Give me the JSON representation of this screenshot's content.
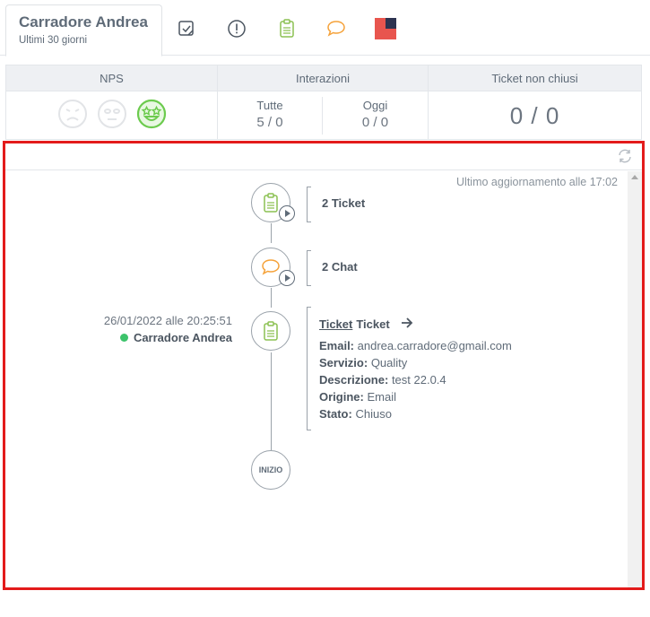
{
  "header": {
    "name": "Carradore Andrea",
    "period": "Ultimi 30 giorni",
    "tabs": [
      {
        "icon": "note-check-icon"
      },
      {
        "icon": "alert-circle-icon"
      },
      {
        "icon": "clipboard-icon",
        "color": "#8cc152"
      },
      {
        "icon": "chat-bubble-icon",
        "color": "#f5a23a"
      },
      {
        "icon": "flag-icon",
        "color": "#e8554e"
      }
    ]
  },
  "stats": {
    "nps": {
      "label": "NPS",
      "faces": [
        "sad-face-icon",
        "neutral-face-icon",
        "star-eyes-face-icon"
      ],
      "active_color": "#6ccb4e"
    },
    "interazioni": {
      "label": "Interazioni",
      "tutte_label": "Tutte",
      "tutte_value": "5 / 0",
      "oggi_label": "Oggi",
      "oggi_value": "0 / 0"
    },
    "ticket": {
      "label": "Ticket non chiusi",
      "value": "0 / 0"
    }
  },
  "timeline": {
    "updated": "Ultimo aggiornamento alle 17:02",
    "events": [
      {
        "title": "2 Ticket",
        "icon": "clipboard-icon"
      },
      {
        "title": "2 Chat",
        "icon": "chat-bubble-icon"
      }
    ],
    "entry": {
      "date": "26/01/2022 alle 20:25:51",
      "agent": "Carradore Andrea",
      "link": "Ticket",
      "type": "Ticket",
      "fields": [
        {
          "key": "Email:",
          "value": "andrea.carradore@gmail.com"
        },
        {
          "key": "Servizio:",
          "value": "Quality"
        },
        {
          "key": "Descrizione:",
          "value": "test 22.0.4"
        },
        {
          "key": "Origine:",
          "value": "Email"
        },
        {
          "key": "Stato:",
          "value": "Chiuso"
        }
      ]
    },
    "start": "INIZIO"
  },
  "colors": {
    "ticket": "#8cc152",
    "chat": "#f5a23a",
    "online": "#3cc36b",
    "highlight": "#e31b1b"
  }
}
